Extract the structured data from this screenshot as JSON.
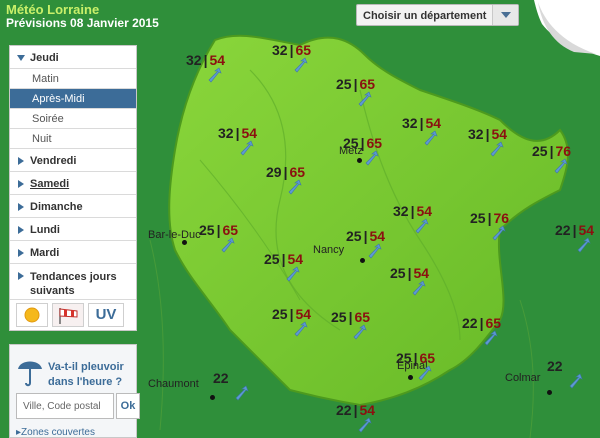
{
  "header": {
    "title": "Météo Lorraine",
    "subtitle": "Prévisions 08 Janvier 2015"
  },
  "department_select": {
    "label": "Choisir un département"
  },
  "sidebar": {
    "days": [
      {
        "label": "Jeudi",
        "open": true,
        "periods": [
          "Matin",
          "Après-Midi",
          "Soirée",
          "Nuit"
        ],
        "active_period": "Après-Midi"
      },
      {
        "label": "Vendredi"
      },
      {
        "label": "Samedi"
      },
      {
        "label": "Dimanche"
      },
      {
        "label": "Lundi"
      },
      {
        "label": "Mardi"
      },
      {
        "label": "Tendances jours suivants"
      }
    ],
    "uv_label": "UV"
  },
  "rain_box": {
    "question": "Va-t-il pleuvoir dans l'heure ?",
    "input_placeholder": "Ville, Code postal",
    "ok_label": "Ok",
    "link_label": "Zones couvertes"
  },
  "cities": [
    "Metz",
    "Nancy",
    "Bar-le-Duc",
    "Épinal",
    "Chaumont",
    "Colmar"
  ],
  "readings": [
    {
      "temp": "32",
      "wind": "54"
    },
    {
      "temp": "32",
      "wind": "65"
    },
    {
      "temp": "25",
      "wind": "65"
    },
    {
      "temp": "32",
      "wind": "54"
    },
    {
      "temp": "25",
      "wind": "65"
    },
    {
      "temp": "32",
      "wind": "54"
    },
    {
      "temp": "32",
      "wind": "54"
    },
    {
      "temp": "25",
      "wind": "76"
    },
    {
      "temp": "29",
      "wind": "65"
    },
    {
      "temp": "32",
      "wind": "54"
    },
    {
      "temp": "25",
      "wind": "76"
    },
    {
      "temp": "25",
      "wind": "65"
    },
    {
      "temp": "25",
      "wind": "54"
    },
    {
      "temp": "22",
      "wind": "54"
    },
    {
      "temp": "25",
      "wind": "54"
    },
    {
      "temp": "25",
      "wind": "54"
    },
    {
      "temp": "25",
      "wind": "54"
    },
    {
      "temp": "25",
      "wind": "65"
    },
    {
      "temp": "22",
      "wind": "65"
    },
    {
      "temp": "25",
      "wind": "65"
    },
    {
      "temp": "22",
      "wind": ""
    },
    {
      "temp": "22",
      "wind": ""
    },
    {
      "temp": "22",
      "wind": "54"
    }
  ],
  "colors": {
    "region": "#7ccf2f",
    "sea": "#2d8a3a",
    "temp_text": "#222222",
    "wind_text": "#8b1010",
    "accent": "#3c6c98"
  }
}
